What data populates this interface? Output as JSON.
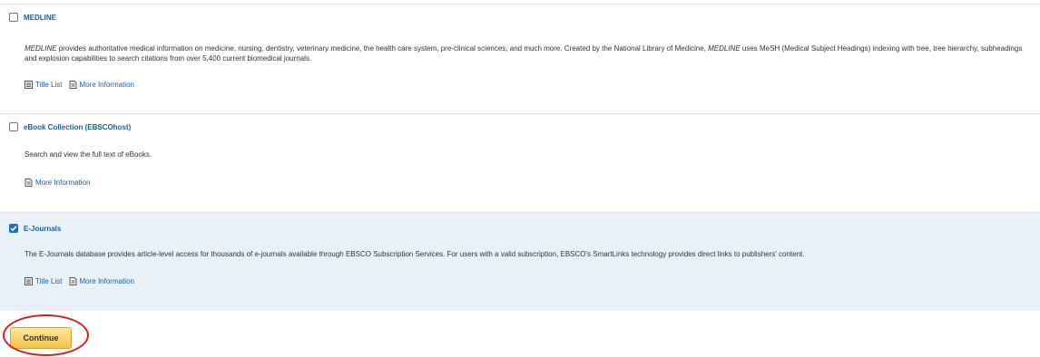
{
  "databases": [
    {
      "title": "MEDLINE",
      "checked": false,
      "description_parts": [
        {
          "text": "MEDLINE",
          "italic": true
        },
        {
          "text": " provides authoritative medical information on medicine, nursing, dentistry, veterinary medicine, the health care system, pre-clinical sciences, and much more. Created by the National Library of Medicine, ",
          "italic": false
        },
        {
          "text": "MEDLINE",
          "italic": true
        },
        {
          "text": " uses MeSH (Medical Subject Headings) indexing with tree, tree hierarchy, subheadings and explosion capabilities to search citations from over 5,400 current biomedical journals.",
          "italic": false
        }
      ],
      "links": {
        "title_list": "Title List",
        "more_info": "More Information"
      }
    },
    {
      "title": "eBook Collection (EBSCOhost)",
      "checked": false,
      "description": "Search and view the full text of eBooks.",
      "links": {
        "more_info": "More Information"
      }
    },
    {
      "title": "E-Journals",
      "checked": true,
      "description": "The E-Journals database provides article-level access for thousands of e-journals available through EBSCO Subscription Services. For users with a valid subscription, EBSCO's SmartLinks technology provides direct links to publishers' content.",
      "links": {
        "title_list": "Title List",
        "more_info": "More Information"
      }
    }
  ],
  "continue_label": "Continue",
  "icons": {
    "title_list": "list-icon",
    "more_info": "document-icon",
    "checkbox_checked": "checkmark-icon"
  },
  "colors": {
    "link": "#1a5fa8",
    "selected_bg": "#e8f1f8",
    "button": "#f4c24a",
    "highlight": "#d81f1f"
  }
}
